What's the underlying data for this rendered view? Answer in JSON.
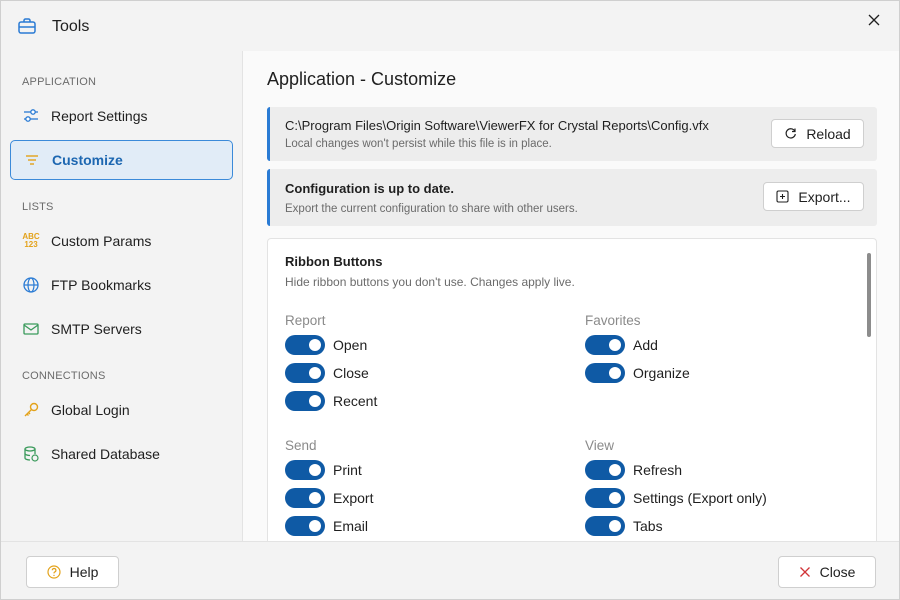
{
  "window": {
    "title": "Tools",
    "briefcase_icon": "briefcase-icon",
    "close_icon": "close-icon"
  },
  "sidebar": {
    "sections": [
      {
        "label": "APPLICATION"
      },
      {
        "label": "LISTS"
      },
      {
        "label": "CONNECTIONS"
      }
    ],
    "items": [
      {
        "label": "Report Settings",
        "icon": "sliders-icon"
      },
      {
        "label": "Customize",
        "icon": "filter-lines-icon",
        "active": true
      },
      {
        "label": "Custom Params",
        "icon": "abc-123-icon"
      },
      {
        "label": "FTP Bookmarks",
        "icon": "globe-icon"
      },
      {
        "label": "SMTP Servers",
        "icon": "mail-icon"
      },
      {
        "label": "Global Login",
        "icon": "key-icon"
      },
      {
        "label": "Shared Database",
        "icon": "database-icon"
      }
    ],
    "abc_glyph_top": "ABC",
    "abc_glyph_bottom": "123"
  },
  "main": {
    "title": "Application - Customize",
    "config_banner": {
      "path": "C:\\Program Files\\Origin Software\\ViewerFX for Crystal Reports\\Config.vfx",
      "note": "Local changes won't persist while this file is in place.",
      "button_label": "Reload"
    },
    "status_banner": {
      "heading": "Configuration is up to date.",
      "note": "Export the current configuration to share with other users.",
      "button_label": "Export..."
    },
    "ribbon": {
      "title": "Ribbon Buttons",
      "subtitle": "Hide ribbon buttons you don't use. Changes apply live.",
      "groups": [
        {
          "label": "Report",
          "items": [
            {
              "label": "Open",
              "on": true
            },
            {
              "label": "Close",
              "on": true
            },
            {
              "label": "Recent",
              "on": true
            }
          ]
        },
        {
          "label": "Favorites",
          "items": [
            {
              "label": "Add",
              "on": true
            },
            {
              "label": "Organize",
              "on": true
            }
          ]
        },
        {
          "label": "Send",
          "items": [
            {
              "label": "Print",
              "on": true
            },
            {
              "label": "Export",
              "on": true
            },
            {
              "label": "Email",
              "on": true
            }
          ]
        },
        {
          "label": "View",
          "items": [
            {
              "label": "Refresh",
              "on": true
            },
            {
              "label": "Settings (Export only)",
              "on": true
            },
            {
              "label": "Tabs",
              "on": true
            }
          ]
        }
      ]
    }
  },
  "footer": {
    "help_label": "Help",
    "close_label": "Close"
  },
  "colors": {
    "accent": "#0f5aa5",
    "active_bg": "#e1ecf7",
    "banner_border": "#2a7bd4",
    "close_red": "#d13438"
  }
}
